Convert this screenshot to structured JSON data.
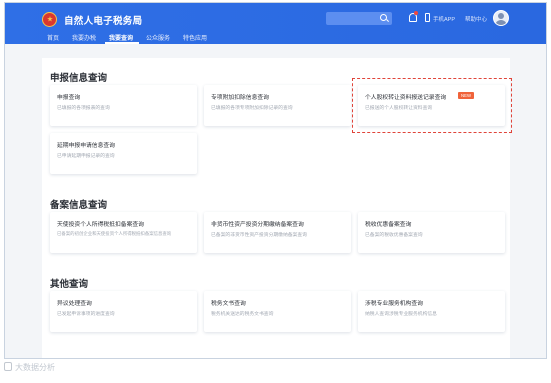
{
  "header": {
    "brand": "自然人电子税务局",
    "mobile_app": "手机APP",
    "help_center": "帮助中心"
  },
  "nav": {
    "items": [
      {
        "label": "首页"
      },
      {
        "label": "我要办税"
      },
      {
        "label": "我要查询"
      },
      {
        "label": "公众服务"
      },
      {
        "label": "特色应用"
      }
    ],
    "active_index": 2
  },
  "sections": [
    {
      "title": "申报信息查询",
      "cards": [
        {
          "title": "申报查询",
          "desc": "已填报的各项报表的查询"
        },
        {
          "title": "专项附加扣除信息查询",
          "desc": "已填报的各项专项附加扣除记录的查询"
        },
        {
          "title": "个人股权转让资料报送记录查询",
          "desc": "已报送的个人股权转让资料查询",
          "badge": "NEW",
          "highlighted": true
        },
        {
          "title": "延期申报申请信息查询",
          "desc": "已申请延期申报记录的查询"
        }
      ]
    },
    {
      "title": "备案信息查询",
      "cards": [
        {
          "title": "天使投资个人所得税抵扣备案查询",
          "desc": "已备案的初创企业和天使投资个人所得税抵扣备案信息查询",
          "desc2": ""
        },
        {
          "title": "非货币性资产投资分期缴纳备案查询",
          "desc": "已备案的非货币性资产投资分期缴纳备案查询"
        },
        {
          "title": "税收优惠备案查询",
          "desc": "已备案的税收优惠备案查询"
        }
      ]
    },
    {
      "title": "其他查询",
      "cards": [
        {
          "title": "异议处理查询",
          "desc": "已发起申诉事项的进度查询"
        },
        {
          "title": "税务文书查询",
          "desc": "税务机关送达的税务文书查询"
        },
        {
          "title": "涉税专业服务机构查询",
          "desc": "纳税人查询涉税专业服务机构信息"
        }
      ]
    }
  ],
  "watermark": "大数据分析",
  "colors": {
    "header_blue": "#2f6fe6",
    "badge_orange": "#f0633a",
    "highlight_red": "#e0443a"
  }
}
